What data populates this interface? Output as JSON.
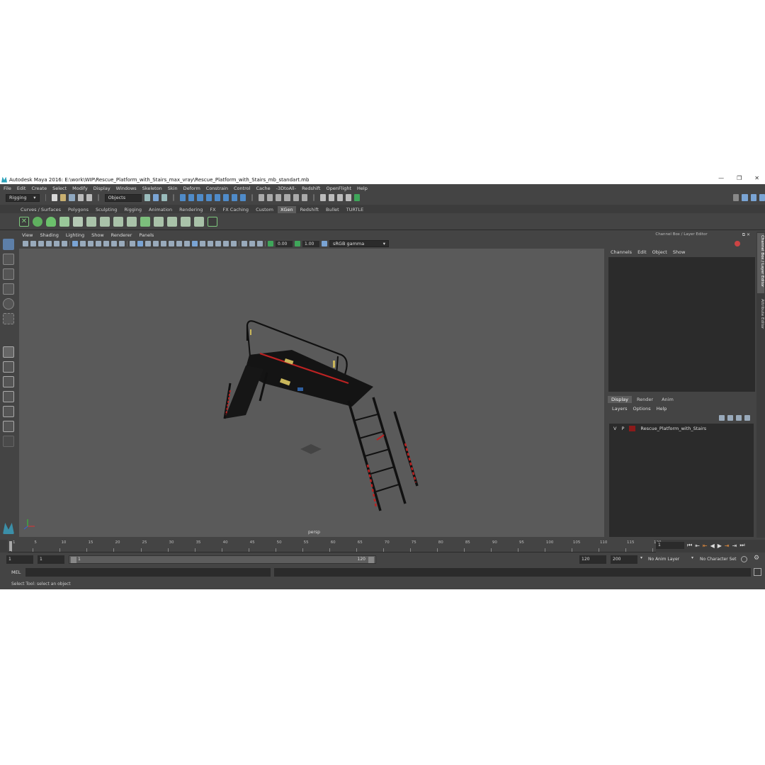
{
  "window": {
    "title": "Autodesk Maya 2016: E:\\work\\WIP\\Rescue_Platform_with_Stairs_max_vray\\Rescue_Platform_with_Stairs_mb_standart.mb",
    "minimize": "—",
    "maximize": "❒",
    "close": "✕"
  },
  "menubar": [
    "File",
    "Edit",
    "Create",
    "Select",
    "Modify",
    "Display",
    "Windows",
    "Skeleton",
    "Skin",
    "Deform",
    "Constrain",
    "Control",
    "Cache",
    "-3DtoAll-",
    "Redshift",
    "OpenFlight",
    "Help"
  ],
  "statusline": {
    "menuset": "Rigging",
    "selection_mode": "Objects"
  },
  "shelf": {
    "tabs": [
      "Curves / Surfaces",
      "Polygons",
      "Sculpting",
      "Rigging",
      "Animation",
      "Rendering",
      "FX",
      "FX Caching",
      "Custom",
      "XGen",
      "Redshift",
      "Bullet",
      "TURTLE"
    ],
    "active_tab": "XGen"
  },
  "viewport": {
    "menu": [
      "View",
      "Shading",
      "Lighting",
      "Show",
      "Renderer",
      "Panels"
    ],
    "exposure": "0.00",
    "gamma": "1.00",
    "colorspace": "sRGB gamma",
    "camera": "persp"
  },
  "right_panel": {
    "title": "Channel Box / Layer Editor",
    "channel_menu": [
      "Channels",
      "Edit",
      "Object",
      "Show"
    ],
    "layer_tabs": [
      "Display",
      "Render",
      "Anim"
    ],
    "active_layer_tab": "Display",
    "layer_menu": [
      "Layers",
      "Options",
      "Help"
    ],
    "layers": [
      {
        "v": "V",
        "p": "P",
        "name": "Rescue_Platform_with_Stairs",
        "color": "#8b1a1a"
      }
    ],
    "side_tabs": [
      "Channel Box / Layer Editor",
      "Attribute Editor"
    ]
  },
  "timeline": {
    "ticks": [
      "1",
      "5",
      "10",
      "15",
      "20",
      "25",
      "30",
      "35",
      "40",
      "45",
      "50",
      "55",
      "60",
      "65",
      "70",
      "75",
      "80",
      "85",
      "90",
      "95",
      "100",
      "105",
      "110",
      "115",
      "120"
    ],
    "current_frame": "1"
  },
  "range": {
    "start": "1",
    "anim_start": "1",
    "slider_start": "1",
    "slider_end": "120",
    "anim_end_field": "120",
    "end": "200",
    "anim_layer": "No Anim Layer",
    "char_set": "No Character Set"
  },
  "cmdline": {
    "lang": "MEL"
  },
  "helpline": "Select Tool: select an object"
}
